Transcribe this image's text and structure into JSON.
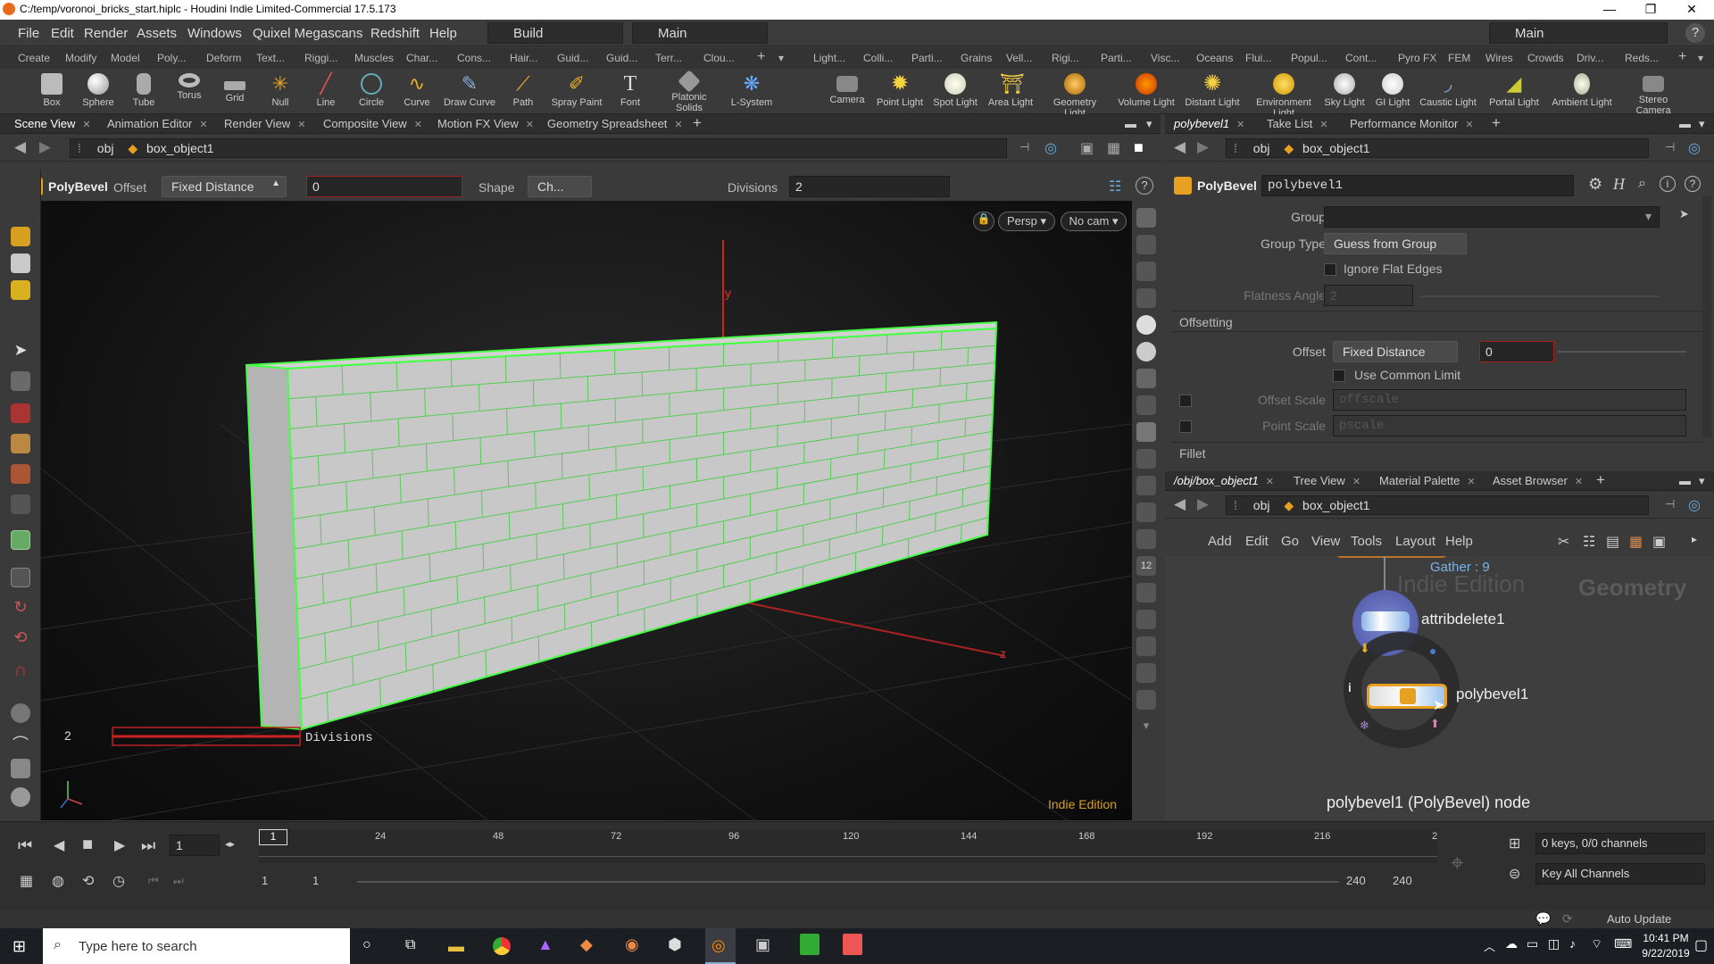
{
  "window": {
    "title": "C:/temp/voronoi_bricks_start.hiplc - Houdini Indie Limited-Commercial 17.5.173"
  },
  "menu": [
    "File",
    "Edit",
    "Render",
    "Assets",
    "Windows",
    "Quixel Megascans",
    "Redshift",
    "Help"
  ],
  "desktop": "Build",
  "desktop_right": "Main",
  "context": "Main",
  "shelf_tabs_left": [
    "Create",
    "Modify",
    "Model",
    "Poly...",
    "Deform",
    "Text...",
    "Riggi...",
    "Muscles",
    "Char...",
    "Cons...",
    "Hair...",
    "Guid...",
    "Guid...",
    "Terr...",
    "Clou..."
  ],
  "shelf_tabs_right": [
    "Light...",
    "Colli...",
    "Parti...",
    "Grains",
    "Vell...",
    "Rigi...",
    "Parti...",
    "Visc...",
    "Oceans",
    "Flui...",
    "Popul...",
    "Cont...",
    "Pyro FX",
    "FEM",
    "Wires",
    "Crowds",
    "Driv...",
    "Reds..."
  ],
  "tools_left": [
    "Box",
    "Sphere",
    "Tube",
    "Torus",
    "Grid",
    "Null",
    "Line",
    "Circle",
    "Curve",
    "Draw Curve",
    "Path",
    "Spray Paint",
    "Font",
    "Platonic Solids",
    "L-System"
  ],
  "tools_right": [
    "Camera",
    "Point Light",
    "Spot Light",
    "Area Light",
    "Geometry Light",
    "Volume Light",
    "Distant Light",
    "Environment Light",
    "Sky Light",
    "GI Light",
    "Caustic Light",
    "Portal Light",
    "Ambient Light",
    "Stereo Camera"
  ],
  "left_tabs": [
    "Scene View",
    "Animation Editor",
    "Render View",
    "Composite View",
    "Motion FX View",
    "Geometry Spreadsheet"
  ],
  "path": {
    "root": "obj",
    "node": "box_object1"
  },
  "op_toolbar": {
    "op": "PolyBevel",
    "offset_label": "Offset",
    "offset_mode": "Fixed Distance",
    "offset_value": "0",
    "shape_label": "Shape",
    "shape_value": "Ch...",
    "divisions_label": "Divisions",
    "divisions_value": "2"
  },
  "viewport": {
    "persp": "Persp",
    "cam": "No cam",
    "watermark": "Indie Edition",
    "hud_value": "2",
    "hud_label": "Divisions",
    "axis_y": "y",
    "axis_z": "z"
  },
  "param_tabs": [
    "polybevel1",
    "Take List",
    "Performance Monitor"
  ],
  "params": {
    "op": "PolyBevel",
    "name": "polybevel1",
    "group_label": "Group",
    "group_value": "",
    "group_type_label": "Group Type",
    "group_type_value": "Guess from Group",
    "ignore_flat": "Ignore Flat Edges",
    "flat_angle_label": "Flatness Angle",
    "flat_angle_value": "2",
    "offsetting": "Offsetting",
    "offset_label": "Offset",
    "offset_mode": "Fixed Distance",
    "offset_value": "0",
    "use_common": "Use Common Limit",
    "offset_scale_label": "Offset Scale",
    "offset_scale_value": "offscale",
    "point_scale_label": "Point Scale",
    "point_scale_value": "pscale",
    "fillet": "Fillet"
  },
  "net_tabs": [
    "/obj/box_object1",
    "Tree View",
    "Material Palette",
    "Asset Browser"
  ],
  "net_menu": [
    "Add",
    "Edit",
    "Go",
    "View",
    "Tools",
    "Layout",
    "Help"
  ],
  "net": {
    "gather": "Gather : 9",
    "watermark1": "Indie Edition",
    "watermark2": "Geometry",
    "node1": "attribdelete1",
    "node2": "polybevel1",
    "info": "polybevel1 (PolyBevel) node"
  },
  "timeline": {
    "frame": "1",
    "ticks": [
      "24",
      "48",
      "72",
      "96",
      "120",
      "144",
      "168",
      "192",
      "216",
      "2"
    ],
    "start": "1",
    "start2": "1",
    "end": "240",
    "end2": "240",
    "keys": "0 keys, 0/0 channels",
    "keyall": "Key All Channels",
    "auto_update": "Auto Update",
    "cur_marker": "1"
  },
  "taskbar": {
    "search": "Type here to search",
    "time": "10:41 PM",
    "date": "9/22/2019"
  }
}
